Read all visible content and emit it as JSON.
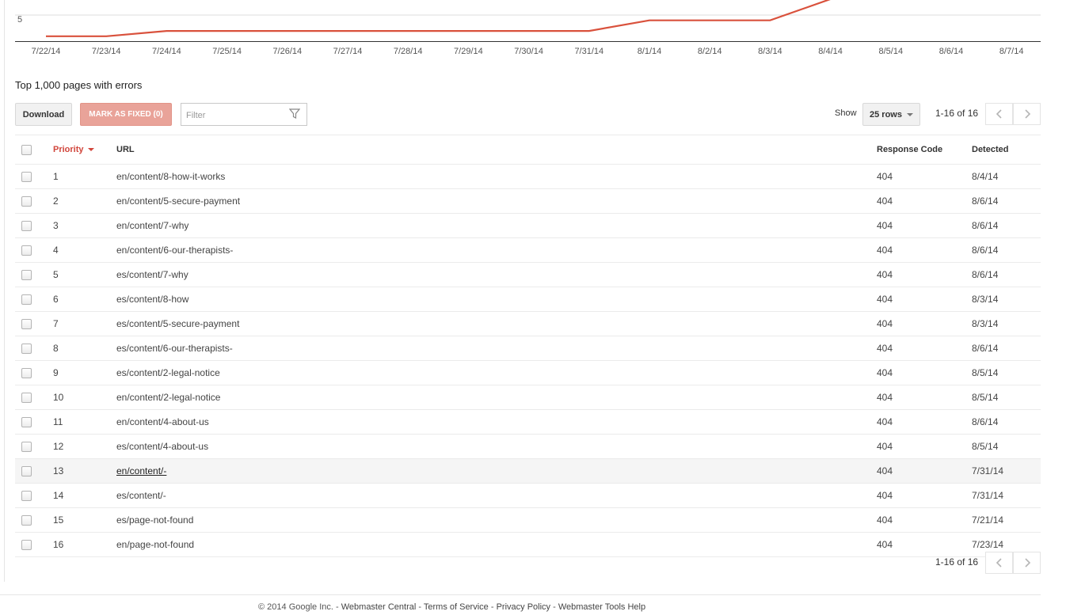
{
  "chart": {
    "y_tick": "5",
    "line_color": "#d9513c"
  },
  "chart_data": {
    "type": "line",
    "categories": [
      "7/22/14",
      "7/23/14",
      "7/24/14",
      "7/25/14",
      "7/26/14",
      "7/27/14",
      "7/28/14",
      "7/29/14",
      "7/30/14",
      "7/31/14",
      "8/1/14",
      "8/2/14",
      "8/3/14",
      "8/4/14",
      "8/5/14",
      "8/6/14",
      "8/7/14"
    ],
    "series": [
      {
        "values": [
          1,
          1,
          2,
          2,
          2,
          2,
          2,
          2,
          2,
          2,
          4,
          4,
          4,
          8
        ]
      }
    ],
    "ylim": [
      0,
      8
    ],
    "grid": true
  },
  "section_title": "Top 1,000 pages with errors",
  "toolbar": {
    "download_label": "Download",
    "mark_fixed_label": "MARK AS FIXED (0)",
    "filter_placeholder": "Filter",
    "show_label": "Show",
    "rows_value": "25 rows",
    "pager_text": "1-16 of 16"
  },
  "table": {
    "headers": {
      "priority": "Priority",
      "url": "URL",
      "response_code": "Response Code",
      "detected": "Detected"
    },
    "rows": [
      {
        "priority": "1",
        "url": "en/content/8-how-it-works",
        "code": "404",
        "detected": "8/4/14"
      },
      {
        "priority": "2",
        "url": "en/content/5-secure-payment",
        "code": "404",
        "detected": "8/6/14"
      },
      {
        "priority": "3",
        "url": "en/content/7-why",
        "code": "404",
        "detected": "8/6/14"
      },
      {
        "priority": "4",
        "url": "en/content/6-our-therapists-",
        "code": "404",
        "detected": "8/6/14"
      },
      {
        "priority": "5",
        "url": "es/content/7-why",
        "code": "404",
        "detected": "8/6/14"
      },
      {
        "priority": "6",
        "url": "es/content/8-how",
        "code": "404",
        "detected": "8/3/14"
      },
      {
        "priority": "7",
        "url": "es/content/5-secure-payment",
        "code": "404",
        "detected": "8/3/14"
      },
      {
        "priority": "8",
        "url": "es/content/6-our-therapists-",
        "code": "404",
        "detected": "8/6/14"
      },
      {
        "priority": "9",
        "url": "es/content/2-legal-notice",
        "code": "404",
        "detected": "8/5/14"
      },
      {
        "priority": "10",
        "url": "en/content/2-legal-notice",
        "code": "404",
        "detected": "8/5/14"
      },
      {
        "priority": "11",
        "url": "en/content/4-about-us",
        "code": "404",
        "detected": "8/6/14"
      },
      {
        "priority": "12",
        "url": "es/content/4-about-us",
        "code": "404",
        "detected": "8/5/14"
      },
      {
        "priority": "13",
        "url": "en/content/-",
        "code": "404",
        "detected": "7/31/14",
        "hovered": true
      },
      {
        "priority": "14",
        "url": "es/content/-",
        "code": "404",
        "detected": "7/31/14"
      },
      {
        "priority": "15",
        "url": "es/page-not-found",
        "code": "404",
        "detected": "7/21/14"
      },
      {
        "priority": "16",
        "url": "en/page-not-found",
        "code": "404",
        "detected": "7/23/14"
      }
    ]
  },
  "bottom_pager_text": "1-16 of 16",
  "footer": {
    "copyright": "© 2014 Google Inc.",
    "sep": " - ",
    "links": [
      "Webmaster Central",
      "Terms of Service",
      "Privacy Policy",
      "Webmaster Tools Help"
    ]
  }
}
